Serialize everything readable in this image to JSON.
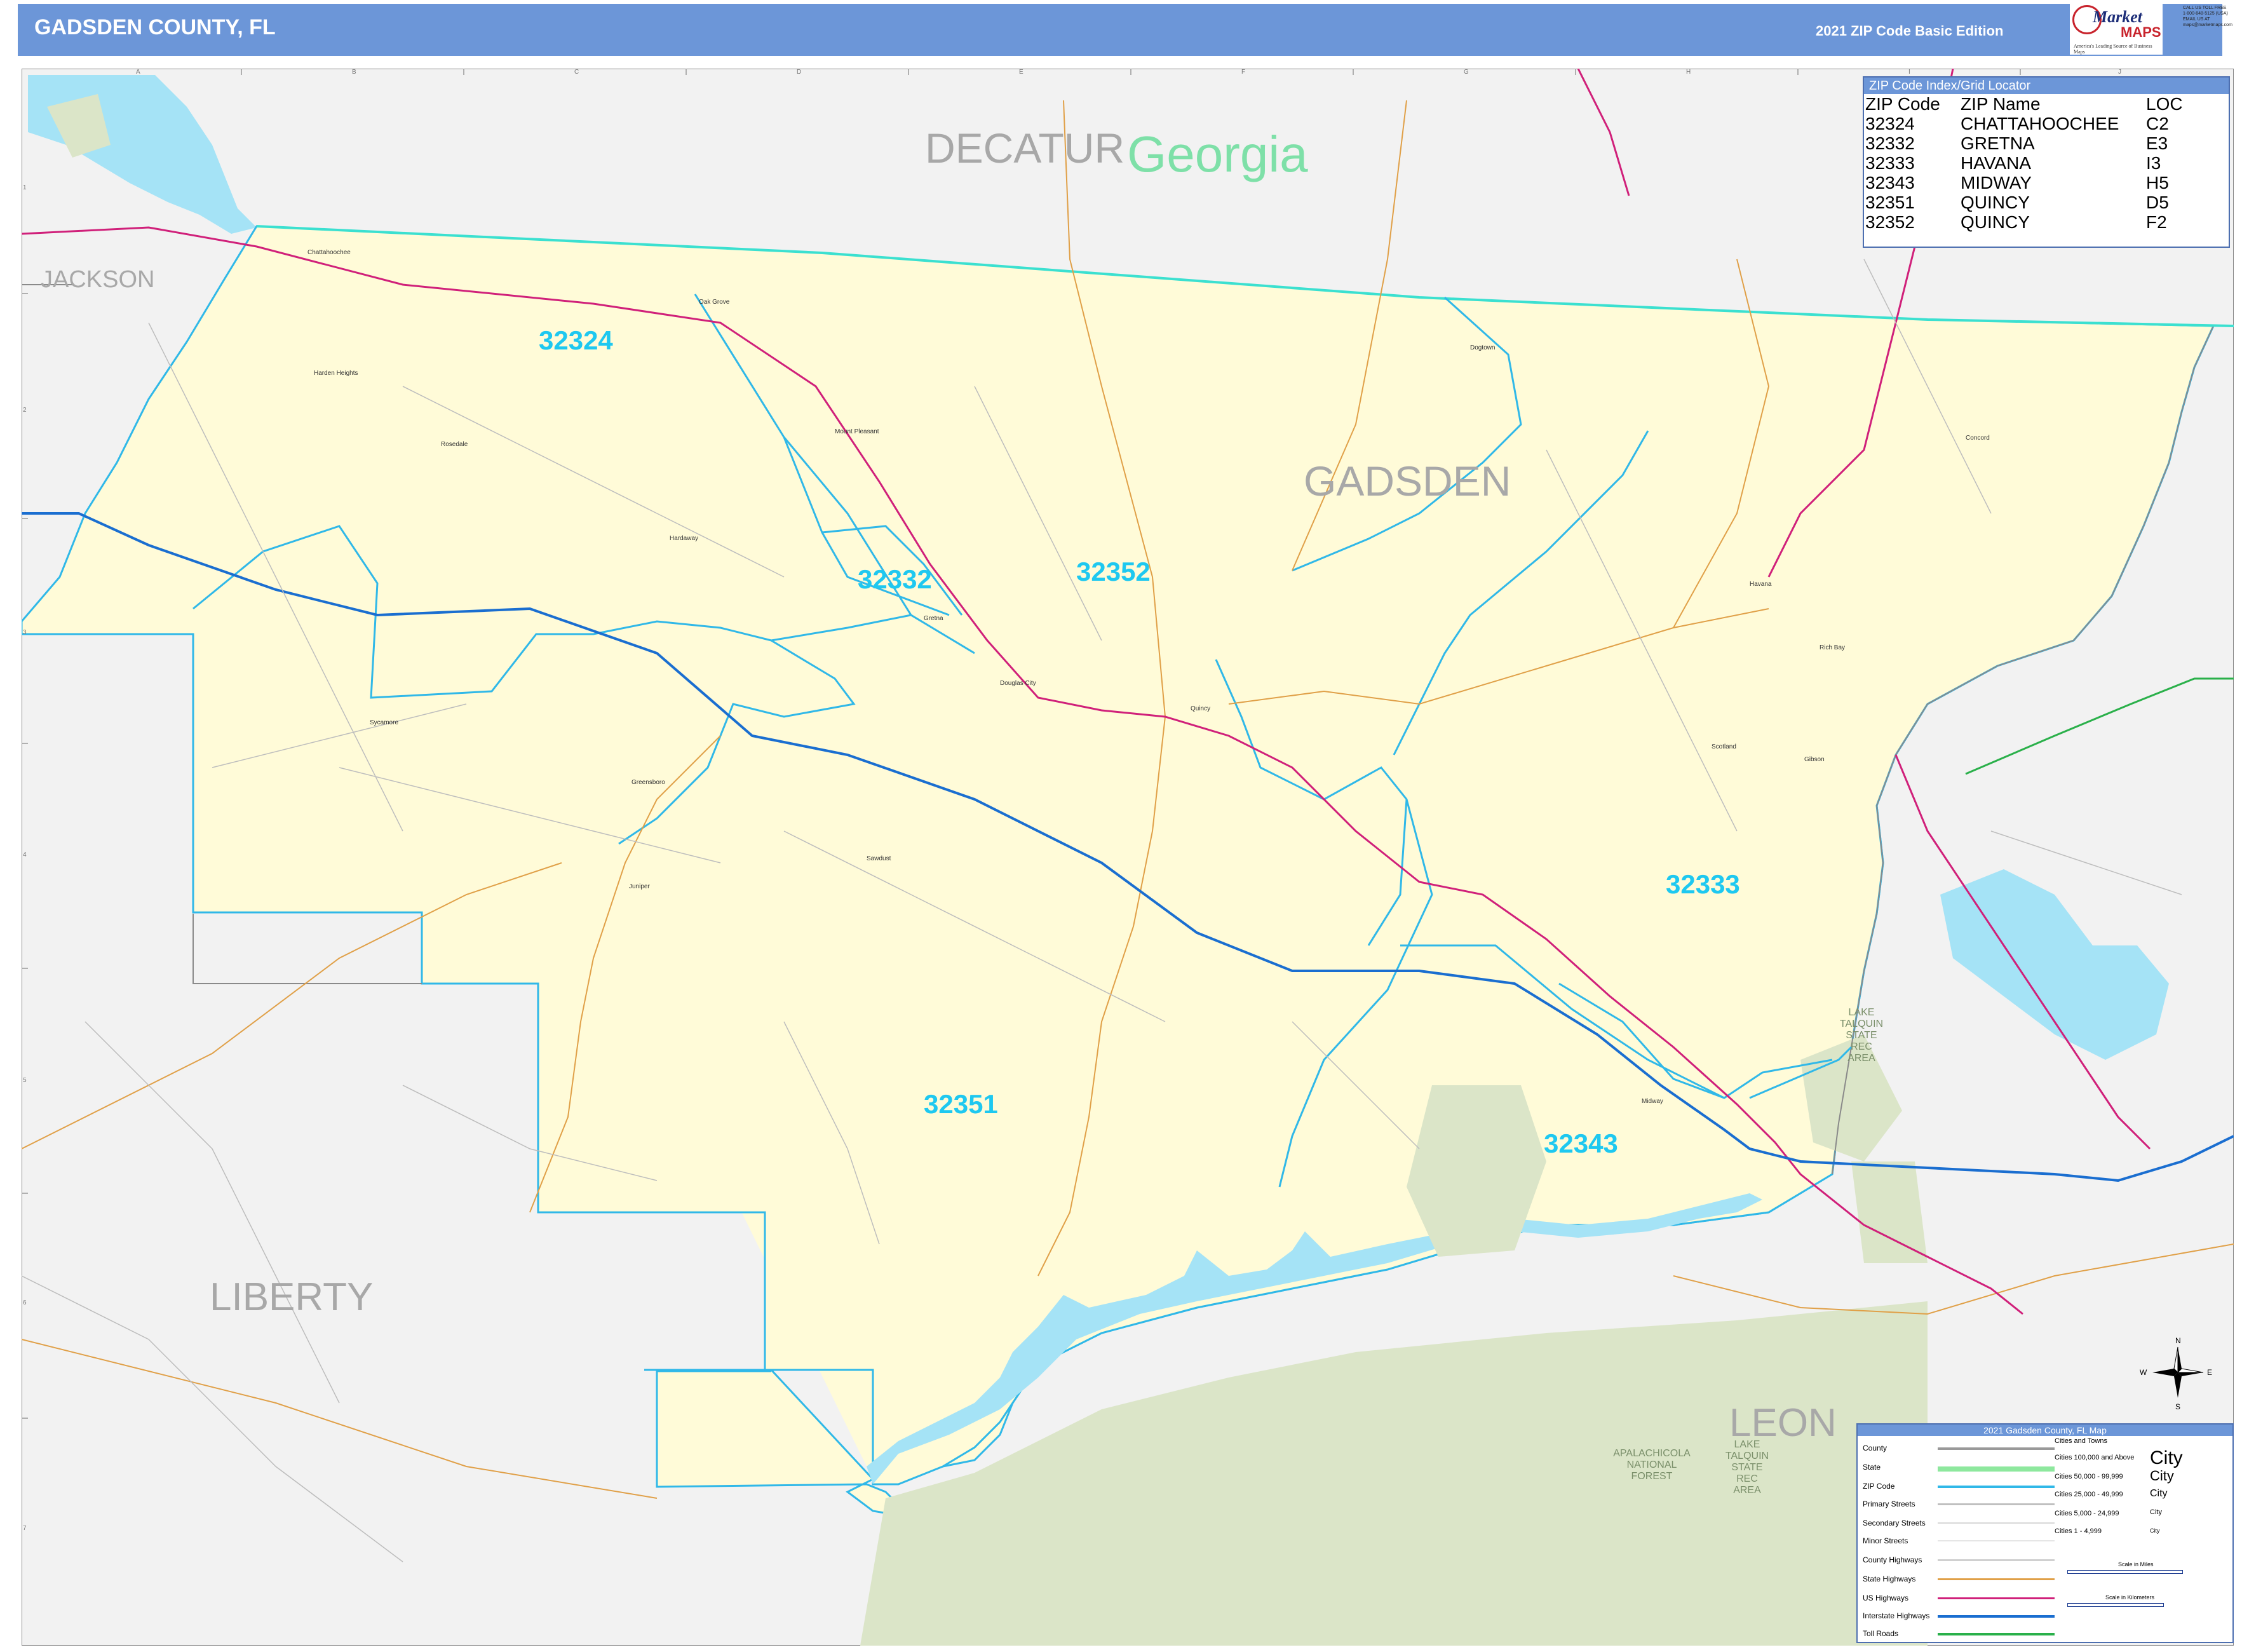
{
  "header": {
    "title": "GADSDEN COUNTY, FL",
    "edition": "2021 ZIP Code Basic Edition"
  },
  "logo": {
    "line1": "Market",
    "line2": "MAPS",
    "tagline": "America's Leading Source of Business Maps"
  },
  "contact": {
    "lines": [
      "CALL US TOLL FREE",
      "1-800-848-5125 (USA)",
      "EMAIL US AT",
      "maps@marketmaps.com"
    ]
  },
  "map": {
    "county_labels": [
      "DECATUR",
      "Georgia",
      "JACKSON",
      "GADSDEN",
      "LIBERTY",
      "LEON"
    ],
    "decatur": "DECATUR",
    "georgia": "Georgia",
    "jackson": "JACKSON",
    "gadsden": "GADSDEN",
    "liberty": "LIBERTY",
    "leon": "LEON",
    "zip_labels": {
      "z32324": "32324",
      "z32332": "32332",
      "z32352": "32352",
      "z32333": "32333",
      "z32351": "32351",
      "z32343": "32343"
    },
    "park_labels": {
      "talquin_a": [
        "LAKE",
        "TALQUIN",
        "STATE",
        "REC",
        "AREA"
      ],
      "talquin_b": [
        "LAKE",
        "TALQUIN",
        "STATE",
        "REC",
        "AREA"
      ],
      "apalachicola": [
        "APALACHICOLA",
        "NATIONAL",
        "FOREST"
      ]
    },
    "places": [
      "Chattahoochee",
      "Harden Heights",
      "Rosedale",
      "Mount Pleasant",
      "Hardaway",
      "Gretna",
      "Douglas City",
      "Quincy",
      "Sycamore",
      "Greensboro",
      "Juniper",
      "Dogtown",
      "Havana",
      "Concord",
      "Scotland",
      "Gibson",
      "Midway",
      "Sawdust",
      "Rich Bay",
      "Oak Grove"
    ],
    "compass": {
      "n": "N",
      "s": "S",
      "e": "E",
      "w": "W"
    },
    "colors": {
      "county_fill": "#fffbd8",
      "outside_fill": "#f2f2f2",
      "water": "#a5e3f6",
      "park": "#dbe5c8",
      "zip_boundary": "#30b8e8",
      "state_line": "#3be0d0",
      "interstate": "#1a6ed0",
      "us_highway": "#d0207a",
      "state_highway": "#e0a048",
      "zip_label": "#1ec8f0",
      "region_label": "#a8a8a8",
      "georgia_label": "#7ee0a8"
    }
  },
  "zip_index": {
    "header": "ZIP Code Index/Grid Locator",
    "columns": [
      "ZIP Code",
      "ZIP Name",
      "LOC"
    ],
    "rows": [
      [
        "32324",
        "CHATTAHOOCHEE",
        "C2"
      ],
      [
        "32332",
        "GRETNA",
        "E3"
      ],
      [
        "32333",
        "HAVANA",
        "I3"
      ],
      [
        "32343",
        "MIDWAY",
        "H5"
      ],
      [
        "32351",
        "QUINCY",
        "D5"
      ],
      [
        "32352",
        "QUINCY",
        "F2"
      ]
    ]
  },
  "legend": {
    "title": "2021 Gadsden County, FL Map",
    "items": [
      "County",
      "State",
      "ZIP Code",
      "Primary Streets",
      "Secondary Streets",
      "Minor Streets",
      "County Highways",
      "State Highways",
      "US Highways",
      "Interstate Highways",
      "Toll Roads"
    ],
    "cities_header": "Cities and Towns",
    "city_sizes": [
      "Cities 100,000 and Above",
      "Cities 50,000 - 99,999",
      "Cities 25,000 - 49,999",
      "Cities 5,000 - 24,999",
      "Cities 1 - 4,999"
    ],
    "city_samples": [
      "City",
      "City",
      "City",
      "City",
      "City"
    ],
    "scale_miles": "Scale in Miles",
    "scale_km": "Scale in Kilometers"
  },
  "grid": {
    "columns": [
      "A",
      "B",
      "C",
      "D",
      "E",
      "F",
      "G",
      "H",
      "I",
      "J"
    ],
    "rows": [
      "1",
      "2",
      "3",
      "4",
      "5",
      "6",
      "7"
    ]
  }
}
